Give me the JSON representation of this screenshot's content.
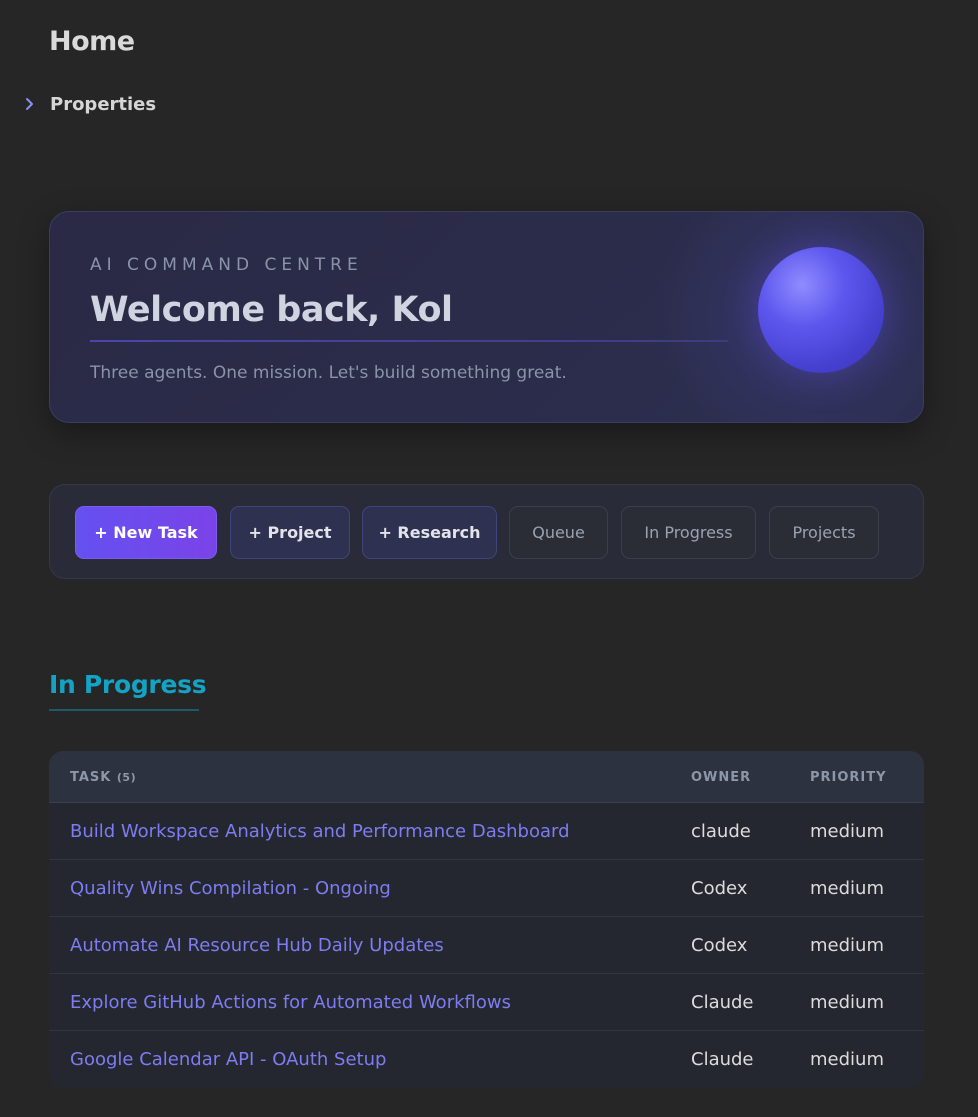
{
  "page": {
    "title": "Home",
    "properties_label": "Properties"
  },
  "hero": {
    "eyebrow": "AI COMMAND CENTRE",
    "title": "Welcome back, Kol",
    "subtitle": "Three agents. One mission. Let's build something great."
  },
  "actions": {
    "new_task": "+ New Task",
    "project": "+ Project",
    "research": "+ Research",
    "queue": "Queue",
    "in_progress": "In Progress",
    "projects": "Projects"
  },
  "section": {
    "title": "In Progress"
  },
  "table": {
    "headers": {
      "task": "TASK",
      "task_count": "(5)",
      "owner": "OWNER",
      "priority": "PRIORITY"
    },
    "rows": [
      {
        "task": "Build Workspace Analytics and Performance Dashboard",
        "owner": "claude",
        "priority": "medium"
      },
      {
        "task": "Quality Wins Compilation - Ongoing",
        "owner": "Codex",
        "priority": "medium"
      },
      {
        "task": "Automate AI Resource Hub Daily Updates",
        "owner": "Codex",
        "priority": "medium"
      },
      {
        "task": "Explore GitHub Actions for Automated Workflows",
        "owner": "Claude",
        "priority": "medium"
      },
      {
        "task": "Google Calendar API - OAuth Setup",
        "owner": "Claude",
        "priority": "medium"
      }
    ]
  },
  "colors": {
    "accent": "#7d7cf0",
    "section_heading": "#14a3c4",
    "primary_button": "#6a4cf0"
  }
}
